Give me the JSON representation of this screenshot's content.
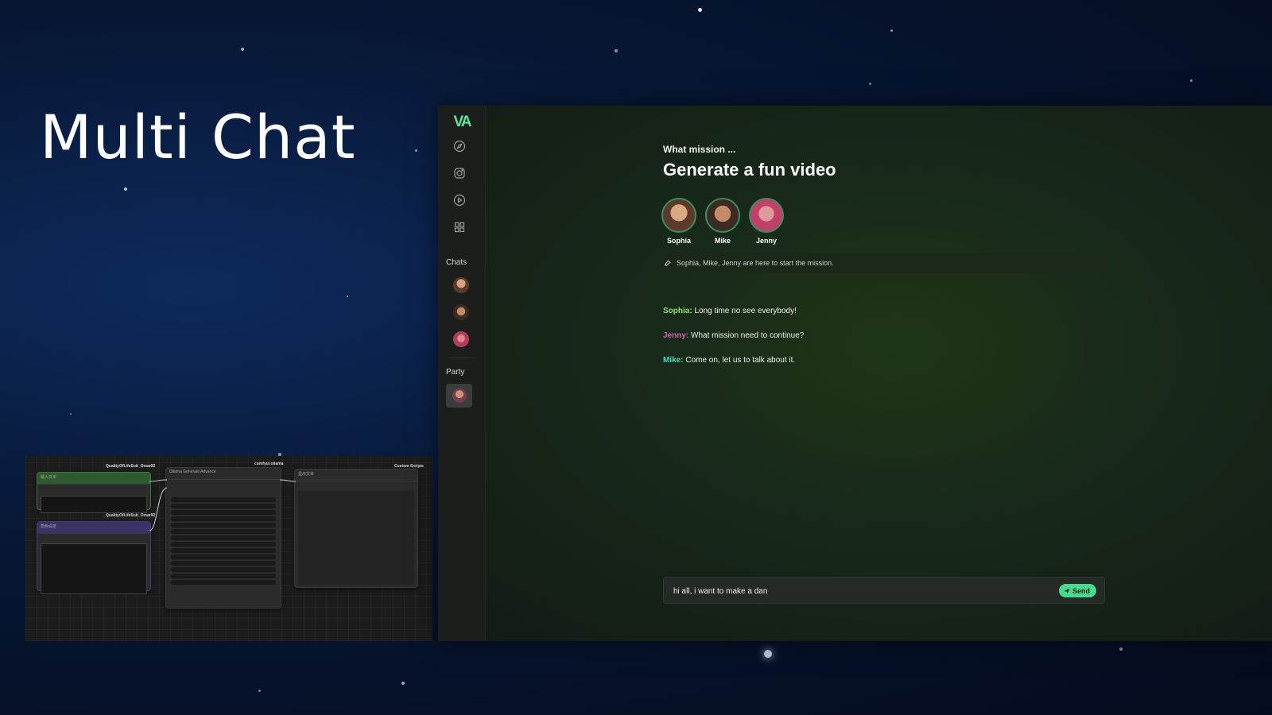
{
  "headline": "Multi Chat",
  "node_editor": {
    "group_tag_1": "QualityOfLifeSuit_Omar92",
    "group_tag_2": "QualityOfLifeSuit_Omar92",
    "group_tag_3": "comfyui ollama",
    "group_tag_4": "Custom Scripts",
    "node_1_title": "输入文本",
    "node_2_title": "角色设定",
    "node_3_title": "Ollama Generate Advance",
    "node_4_title": "显示文本"
  },
  "sidebar": {
    "logo": "VA",
    "nav": [
      {
        "name": "explore-icon"
      },
      {
        "name": "instagram-icon"
      },
      {
        "name": "play-icon"
      },
      {
        "name": "apps-icon"
      }
    ],
    "chats_label": "Chats",
    "party_label": "Party"
  },
  "main": {
    "label": "What mission ...",
    "title": "Generate a fun video",
    "members": [
      {
        "name": "Sophia",
        "color": "#b88a6a"
      },
      {
        "name": "Mike",
        "color": "#a8735a"
      },
      {
        "name": "Jenny",
        "color": "#c8506e"
      }
    ],
    "system_message": "Sophia, Mike, Jenny are here to start the mission.",
    "messages": [
      {
        "who": "Sophia:",
        "text": " Long time no see everybody!",
        "color": "#8ee06b"
      },
      {
        "who": "Jenny:",
        "text": " What mission need to continue?",
        "color": "#d95fb0"
      },
      {
        "who": "Mike:",
        "text": " Come on, let us to talk about it.",
        "color": "#4fd6c0"
      }
    ],
    "input_value": "hi all, i want to make a dan",
    "send_label": "Send"
  },
  "colors": {
    "accent": "#49d98d",
    "logo": "#5ee3a0"
  }
}
